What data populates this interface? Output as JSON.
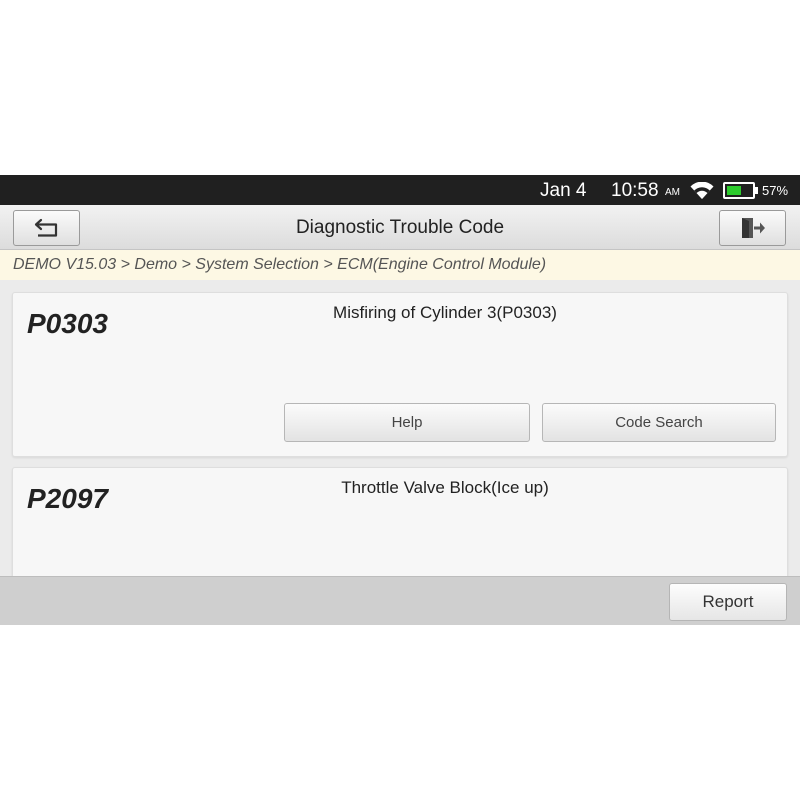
{
  "status_bar": {
    "date": "Jan 4",
    "time": "10:58",
    "ampm": "AM",
    "battery_percent": "57%",
    "battery_level": 0.57,
    "battery_color": "#2dcc2d",
    "icons": [
      "wifi-icon",
      "battery-icon"
    ]
  },
  "header": {
    "title": "Diagnostic Trouble Code",
    "back_icon": "back-arrow-icon",
    "exit_icon": "exit-door-icon"
  },
  "breadcrumb": "DEMO V15.03 > Demo > System Selection > ECM(Engine Control Module)",
  "dtc_list": [
    {
      "code": "P0303",
      "description": "Misfiring of Cylinder 3(P0303)",
      "help_label": "Help",
      "code_search_label": "Code Search"
    },
    {
      "code": "P2097",
      "description": "Throttle Valve Block(Ice up)"
    }
  ],
  "footer": {
    "report_label": "Report"
  }
}
